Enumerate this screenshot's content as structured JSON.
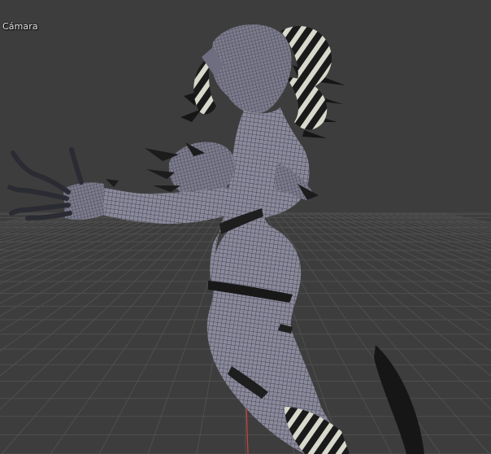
{
  "viewport": {
    "view_label": "Cámara",
    "colors": {
      "background": "#3d3d3d",
      "grid_line": "#4f4f4f",
      "mesh_fill": "#8a8a9c",
      "wireframe": "#2a2a33",
      "dark_parts": "#1c1c1c",
      "z_axis": "#d04040"
    },
    "object": {
      "icon": "figure-mesh-icon",
      "shading": "solid-with-wireframe"
    }
  }
}
